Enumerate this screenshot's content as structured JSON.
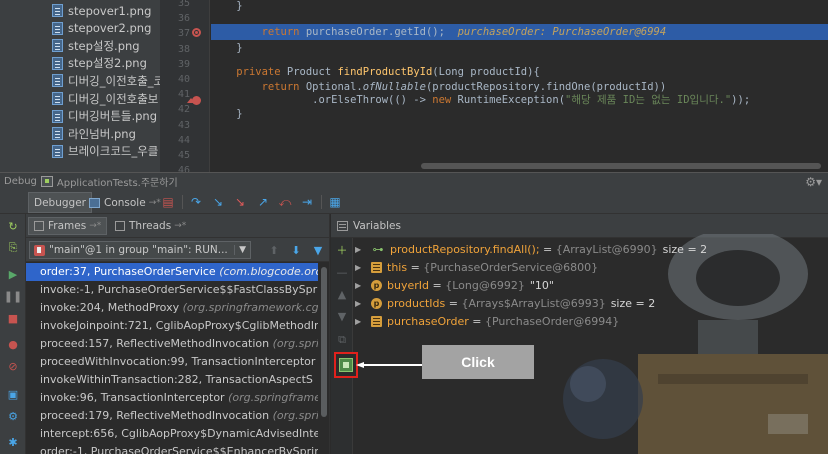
{
  "project_files": [
    {
      "name": "stepover1.png"
    },
    {
      "name": "stepover2.png"
    },
    {
      "name": "step설정.png"
    },
    {
      "name": "step설정2.png"
    },
    {
      "name": "디버깅_이전호출_코"
    },
    {
      "name": "디버깅_이전호출보"
    },
    {
      "name": "디버깅버튼들.png"
    },
    {
      "name": "라인넘버.png"
    },
    {
      "name": "브레이크코드_우클"
    }
  ],
  "editor": {
    "line_numbers": [
      "35",
      "36",
      "37",
      "38",
      "39",
      "40",
      "41",
      "42",
      "43",
      "44",
      "45",
      "46"
    ],
    "lines": {
      "l35": "    }",
      "l37_kw": "return",
      "l37_code": " purchaseOrder.getId();",
      "l37_inline": "purchaseOrder: PurchaseOrder@6994",
      "l38": "}",
      "l40_kw": "private",
      "l40_type": " Product ",
      "l40_fn": "findProductById",
      "l40_rest": "(Long productId){",
      "l41_kw": "return",
      "l41_a": " Optional.",
      "l41_it": "ofNullable",
      "l41_b": "(productRepository.findOne(productId))",
      "l42_a": ".orElseThrow(() -> ",
      "l42_kw": "new",
      "l42_b": " RuntimeException(",
      "l42_str": "\"해당 제품 ID는 없는 ID입니다.\"",
      "l42_c": "));",
      "l43": "}"
    }
  },
  "debug_window": {
    "title_prefix": "Debug",
    "config_name": "ApplicationTests.주문하기",
    "settings_icon": "gear-icon"
  },
  "toolbar": {
    "debugger_tab": "Debugger",
    "console_tab": "Console",
    "console_suffix": "→*"
  },
  "frames_panel": {
    "frames_tab": "Frames",
    "frames_suffix": "→*",
    "threads_tab": "Threads",
    "threads_suffix": "→*",
    "thread_selected": "\"main\"@1 in group \"main\": RUN...",
    "frames": [
      {
        "method": "order:37, PurchaseOrderService",
        "pkg": "(com.blogcode.orc",
        "selected": true
      },
      {
        "method": "invoke:-1, PurchaseOrderService$$FastClassBySpr",
        "pkg": "",
        "selected": false
      },
      {
        "method": "invoke:204, MethodProxy",
        "pkg": "(org.springframework.cg",
        "selected": false
      },
      {
        "method": "invokeJoinpoint:721, CglibAopProxy$CglibMethodIr",
        "pkg": "",
        "selected": false
      },
      {
        "method": "proceed:157, ReflectiveMethodInvocation",
        "pkg": "(org.spri",
        "selected": false
      },
      {
        "method": "proceedWithInvocation:99, TransactionInterceptor",
        "pkg": "",
        "selected": false
      },
      {
        "method": "invokeWithinTransaction:282, TransactionAspectS",
        "pkg": "",
        "selected": false
      },
      {
        "method": "invoke:96, TransactionInterceptor",
        "pkg": "(org.springframe",
        "selected": false
      },
      {
        "method": "proceed:179, ReflectiveMethodInvocation",
        "pkg": "(org.spri",
        "selected": false
      },
      {
        "method": "intercept:656, CglibAopProxy$DynamicAdvisedInte",
        "pkg": "",
        "selected": false
      },
      {
        "method": "order:-1, PurchaseOrderService$$EnhancerBySprin",
        "pkg": "",
        "selected": false
      }
    ]
  },
  "variables_panel": {
    "title": "Variables",
    "vars": [
      {
        "name": "productRepository.findAll();",
        "eq": " = ",
        "val": "{ArrayList@6990}",
        "extra": "size = 2",
        "icon": "watch"
      },
      {
        "name": "this",
        "eq": " = ",
        "val": "{PurchaseOrderService@6800}",
        "extra": "",
        "icon": "field"
      },
      {
        "name": "buyerId",
        "eq": " = ",
        "val": "{Long@6992}",
        "extra": "\"10\"",
        "icon": "param"
      },
      {
        "name": "productIds",
        "eq": " = ",
        "val": "{Arrays$ArrayList@6993}",
        "extra": "size = 2",
        "icon": "param"
      },
      {
        "name": "purchaseOrder",
        "eq": " = ",
        "val": "{PurchaseOrder@6994}",
        "extra": "",
        "icon": "field"
      }
    ]
  },
  "annotation": {
    "callout_label": "Click",
    "highlight_color": "#e0211c"
  },
  "colors": {
    "selection": "#2f65ca",
    "exec_line": "#2d5ca6",
    "breakpoint": "#c75450",
    "var_name": "#f0a33a"
  }
}
